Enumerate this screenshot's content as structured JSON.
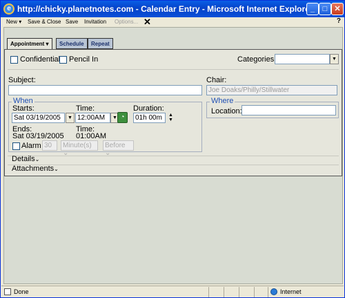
{
  "window": {
    "title": "http://chicky.planetnotes.com - Calendar Entry - Microsoft Internet Explorer"
  },
  "menubar": {
    "new": "New",
    "save_close": "Save & Close",
    "save": "Save",
    "invitation": "Invitation",
    "options": "Options...",
    "close": "✕",
    "help": "?"
  },
  "tabs": [
    {
      "label": "Appointment ▾"
    },
    {
      "label": "Schedule"
    },
    {
      "label": "Repeat"
    }
  ],
  "form": {
    "confidential_label": "Confidential",
    "pencil_in_label": "Pencil In",
    "categories_label": "Categories:",
    "categories_value": "",
    "subject_label": "Subject:",
    "subject_value": "",
    "chair_label": "Chair:",
    "chair_value": "Joe Doaks/Philly/Stillwater",
    "when_legend": "When",
    "starts_label": "Starts:",
    "starts_value": "Sat 03/19/2005",
    "start_time_label": "Time:",
    "start_time_value": "12:00AM",
    "duration_label": "Duration:",
    "duration_value": "01h 00m",
    "ends_label": "Ends:",
    "ends_value": "Sat 03/19/2005",
    "end_time_label": "Time:",
    "end_time_value": "01:00AM",
    "alarm_label": "Alarm",
    "alarm_amount": "30",
    "alarm_unit": "Minute(s)",
    "alarm_when": "Before",
    "where_legend": "Where",
    "location_label": "Location:",
    "location_value": "",
    "details_label": "Details",
    "attachments_label": "Attachments"
  },
  "status": {
    "left": "Done",
    "zone": "Internet"
  },
  "colors": {
    "titlebar": "#0542c8",
    "legend": "#1f4fb4",
    "panel": "#e6e6dc"
  }
}
